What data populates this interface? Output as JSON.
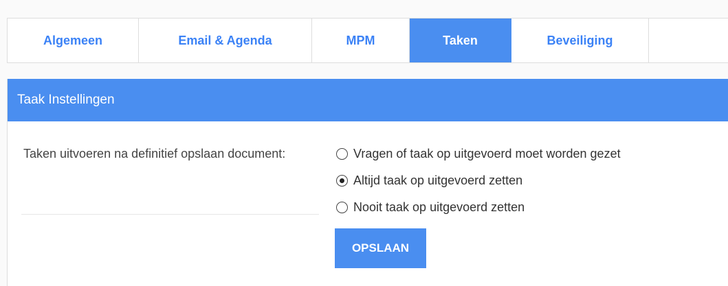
{
  "tabs": [
    {
      "label": "Algemeen",
      "active": false
    },
    {
      "label": "Email & Agenda",
      "active": false
    },
    {
      "label": "MPM",
      "active": false
    },
    {
      "label": "Taken",
      "active": true
    },
    {
      "label": "Beveiliging",
      "active": false
    }
  ],
  "panel": {
    "title": "Taak Instellingen",
    "setting_label": "Taken uitvoeren na definitief opslaan document:",
    "options": [
      {
        "label": "Vragen of taak op uitgevoerd moet worden gezet",
        "checked": false
      },
      {
        "label": "Altijd taak op uitgevoerd zetten",
        "checked": true
      },
      {
        "label": "Nooit taak op uitgevoerd zetten",
        "checked": false
      }
    ],
    "save_label": "OPSLAAN"
  },
  "colors": {
    "accent": "#4a8ef0",
    "tab_text": "#3b82f6",
    "border": "#dddddd"
  }
}
